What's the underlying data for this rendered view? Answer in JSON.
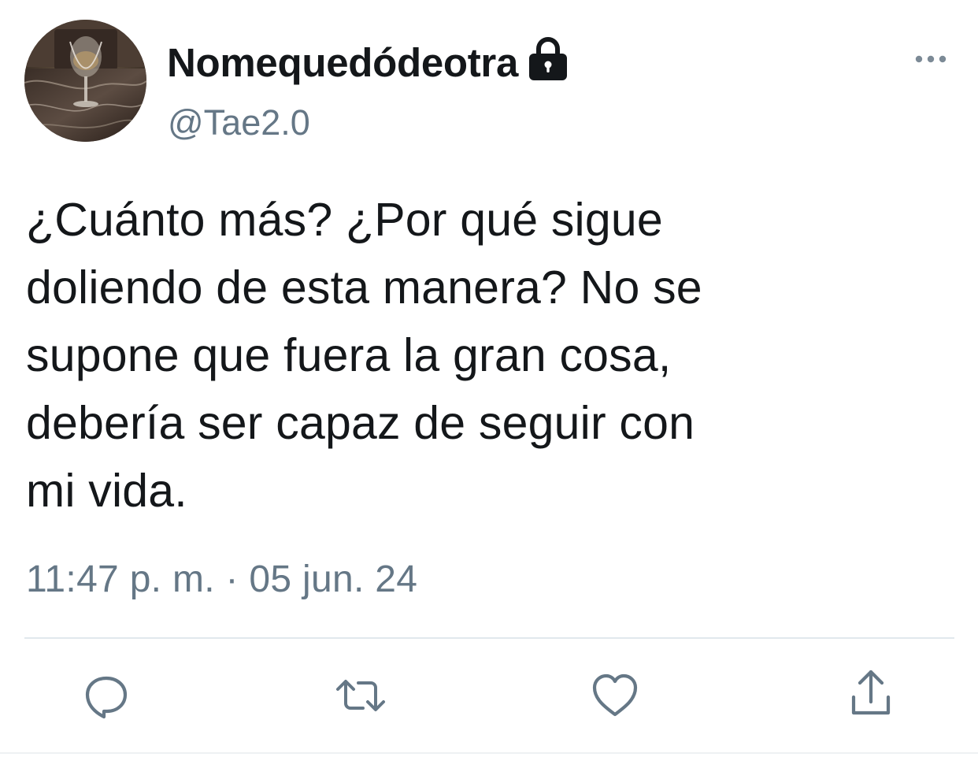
{
  "author": {
    "display_name": "Nomequedódeotra",
    "handle": "@Tae2.0",
    "protected": true,
    "lock_icon": "lock-icon",
    "avatar_icon": "avatar-photo"
  },
  "header": {
    "more_icon": "more-horizontal-icon"
  },
  "tweet": {
    "text": "¿Cuánto más? ¿Por qué sigue\ndoliendo de esta manera? No se\nsupone que fuera la gran cosa,\ndebería ser capaz de seguir con\nmi vida.",
    "timestamp": "11:47 p. m. · 05 jun. 24"
  },
  "actions": [
    {
      "name": "reply",
      "icon": "reply-icon"
    },
    {
      "name": "retweet",
      "icon": "retweet-icon"
    },
    {
      "name": "like",
      "icon": "heart-icon"
    },
    {
      "name": "share",
      "icon": "share-icon"
    }
  ],
  "colors": {
    "text_primary": "#14171a",
    "text_secondary": "#657786",
    "icon_gray": "#657786",
    "divider": "#e1e8ed"
  }
}
